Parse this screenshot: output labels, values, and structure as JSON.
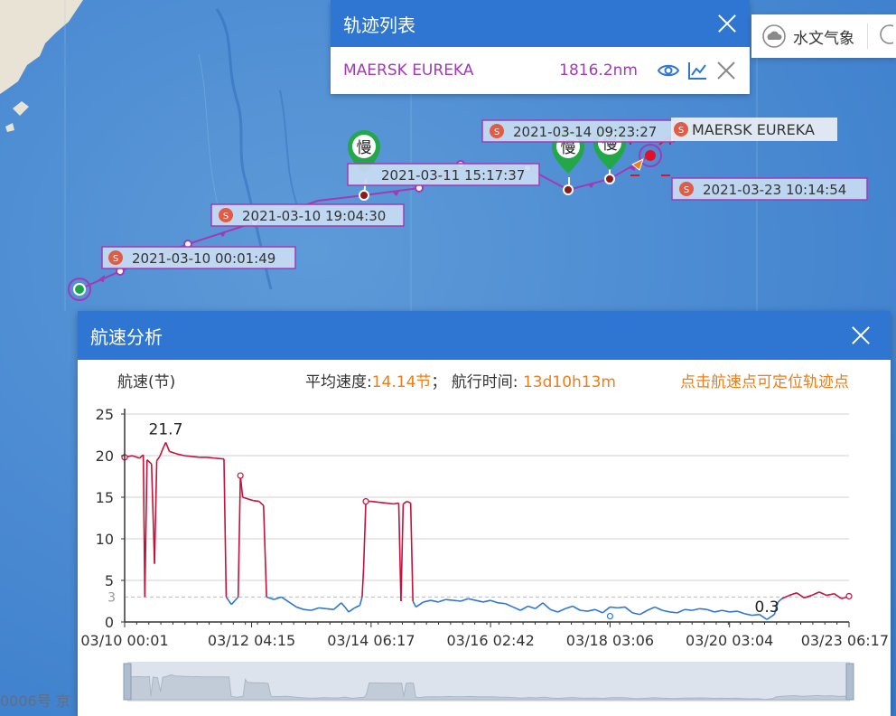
{
  "map": {
    "footer_text": "0006号   京"
  },
  "track_points": [
    {
      "label": "2021-03-10 00:01:49",
      "badge": "S"
    },
    {
      "label": "2021-03-10 19:04:30",
      "badge": "S"
    },
    {
      "label": "2021-03-11 15:17:37",
      "badge": ""
    },
    {
      "label": "2021-03-14 09:23:27",
      "badge": "S"
    },
    {
      "label": "2021-03-23 10:14:54",
      "badge": "S"
    }
  ],
  "ship_label": {
    "badge": "S",
    "name": "MAERSK EUREKA"
  },
  "slow_markers": [
    "慢",
    "慢",
    "慢"
  ],
  "track_panel": {
    "title": "轨迹列表",
    "ship_name": "MAERSK EUREKA",
    "distance": "1816.2nm",
    "icons": [
      "eye-icon",
      "line-chart-icon",
      "close-icon"
    ]
  },
  "weather_bar": {
    "label": "水文气象",
    "icon": "cloud-icon"
  },
  "speed_panel": {
    "title": "航速分析",
    "ylabel": "航速(节)",
    "avg_label": "平均速度:",
    "avg_value": "14.14节",
    "sep": "；",
    "duration_label": "航行时间:",
    "duration_value": "13d10h13m",
    "hint": "点击航速点可定位轨迹点"
  },
  "chart_data": {
    "type": "line",
    "xlabel": "",
    "ylabel": "航速(节)",
    "ylim": [
      0,
      25
    ],
    "yticks": [
      0,
      5,
      10,
      15,
      20,
      25
    ],
    "reference_line": {
      "value": 3,
      "label": "3"
    },
    "xtick_labels": [
      "03/10 00:01",
      "03/12 04:15",
      "03/14 06:17",
      "03/16 02:42",
      "03/18 03:06",
      "03/20 03:04",
      "03/23 06:17"
    ],
    "xtick_positions": [
      0,
      1.7,
      3.3,
      4.9,
      6.5,
      8.1,
      9.7
    ],
    "x_max": 9.7,
    "annotations": [
      {
        "text": "21.7",
        "x": 0.55,
        "y": 21.7
      },
      {
        "text": "0.3",
        "x": 8.6,
        "y": 0.3
      }
    ],
    "colors": {
      "high": "#c8103a",
      "low": "#2f76d2",
      "grid": "#d0d0d0",
      "ref": "#bdbdbd"
    },
    "series": [
      {
        "points": [
          [
            0.0,
            19.8
          ],
          [
            0.1,
            20.0
          ],
          [
            0.2,
            19.7
          ],
          [
            0.25,
            20.1
          ],
          [
            0.27,
            3.0
          ],
          [
            0.3,
            19.5
          ],
          [
            0.36,
            19.0
          ],
          [
            0.4,
            7.0
          ],
          [
            0.43,
            19.4
          ],
          [
            0.47,
            19.9
          ],
          [
            0.52,
            21.0
          ],
          [
            0.55,
            21.6
          ],
          [
            0.6,
            20.5
          ],
          [
            0.7,
            20.2
          ],
          [
            0.8,
            20.0
          ],
          [
            0.9,
            19.9
          ],
          [
            1.0,
            19.8
          ],
          [
            1.1,
            19.8
          ],
          [
            1.2,
            19.7
          ],
          [
            1.33,
            19.6
          ],
          [
            1.36,
            3.0
          ],
          [
            1.43,
            2.1
          ],
          [
            1.48,
            2.6
          ],
          [
            1.52,
            3.0
          ],
          [
            1.55,
            17.6
          ],
          [
            1.58,
            15.0
          ],
          [
            1.65,
            14.8
          ],
          [
            1.72,
            14.6
          ],
          [
            1.8,
            14.5
          ],
          [
            1.86,
            14.0
          ],
          [
            1.9,
            3.0
          ],
          [
            2.0,
            2.7
          ],
          [
            2.1,
            3.0
          ],
          [
            2.2,
            2.4
          ],
          [
            2.3,
            1.8
          ],
          [
            2.4,
            1.5
          ],
          [
            2.5,
            1.4
          ],
          [
            2.6,
            1.7
          ],
          [
            2.7,
            1.6
          ],
          [
            2.8,
            1.5
          ],
          [
            2.9,
            2.3
          ],
          [
            2.95,
            1.8
          ],
          [
            3.0,
            1.2
          ],
          [
            3.08,
            1.7
          ],
          [
            3.15,
            2.0
          ],
          [
            3.18,
            3.0
          ],
          [
            3.2,
            6.5
          ],
          [
            3.23,
            14.5
          ],
          [
            3.3,
            14.5
          ],
          [
            3.4,
            14.4
          ],
          [
            3.5,
            14.3
          ],
          [
            3.6,
            14.2
          ],
          [
            3.67,
            14.3
          ],
          [
            3.7,
            2.5
          ],
          [
            3.73,
            14.2
          ],
          [
            3.78,
            14.5
          ],
          [
            3.83,
            14.3
          ],
          [
            3.86,
            2.5
          ],
          [
            3.9,
            1.8
          ],
          [
            4.0,
            2.4
          ],
          [
            4.1,
            2.6
          ],
          [
            4.2,
            2.4
          ],
          [
            4.3,
            2.7
          ],
          [
            4.4,
            2.6
          ],
          [
            4.5,
            2.5
          ],
          [
            4.6,
            2.8
          ],
          [
            4.7,
            2.6
          ],
          [
            4.8,
            2.4
          ],
          [
            4.9,
            2.6
          ],
          [
            5.0,
            2.3
          ],
          [
            5.1,
            2.2
          ],
          [
            5.2,
            1.8
          ],
          [
            5.3,
            1.4
          ],
          [
            5.4,
            1.9
          ],
          [
            5.5,
            1.6
          ],
          [
            5.6,
            2.3
          ],
          [
            5.7,
            1.5
          ],
          [
            5.8,
            1.2
          ],
          [
            5.9,
            1.6
          ],
          [
            6.0,
            1.9
          ],
          [
            6.1,
            1.4
          ],
          [
            6.2,
            1.3
          ],
          [
            6.3,
            1.5
          ],
          [
            6.4,
            1.1
          ],
          [
            6.5,
            1.8
          ],
          [
            6.6,
            1.7
          ],
          [
            6.7,
            1.8
          ],
          [
            6.8,
            1.1
          ],
          [
            6.9,
            0.9
          ],
          [
            7.0,
            1.4
          ],
          [
            7.1,
            1.8
          ],
          [
            7.2,
            1.4
          ],
          [
            7.3,
            1.2
          ],
          [
            7.4,
            1.1
          ],
          [
            7.5,
            1.5
          ],
          [
            7.6,
            1.4
          ],
          [
            7.7,
            1.6
          ],
          [
            7.8,
            1.5
          ],
          [
            7.9,
            1.2
          ],
          [
            8.0,
            1.4
          ],
          [
            8.1,
            1.2
          ],
          [
            8.2,
            1.3
          ],
          [
            8.3,
            1.0
          ],
          [
            8.4,
            0.8
          ],
          [
            8.5,
            0.9
          ],
          [
            8.6,
            0.3
          ],
          [
            8.7,
            0.9
          ],
          [
            8.75,
            2.4
          ],
          [
            8.8,
            2.8
          ],
          [
            8.9,
            3.2
          ],
          [
            9.0,
            3.5
          ],
          [
            9.1,
            2.9
          ],
          [
            9.2,
            3.2
          ],
          [
            9.3,
            3.6
          ],
          [
            9.4,
            3.2
          ],
          [
            9.5,
            3.4
          ],
          [
            9.6,
            2.8
          ],
          [
            9.7,
            3.1
          ]
        ]
      }
    ]
  }
}
